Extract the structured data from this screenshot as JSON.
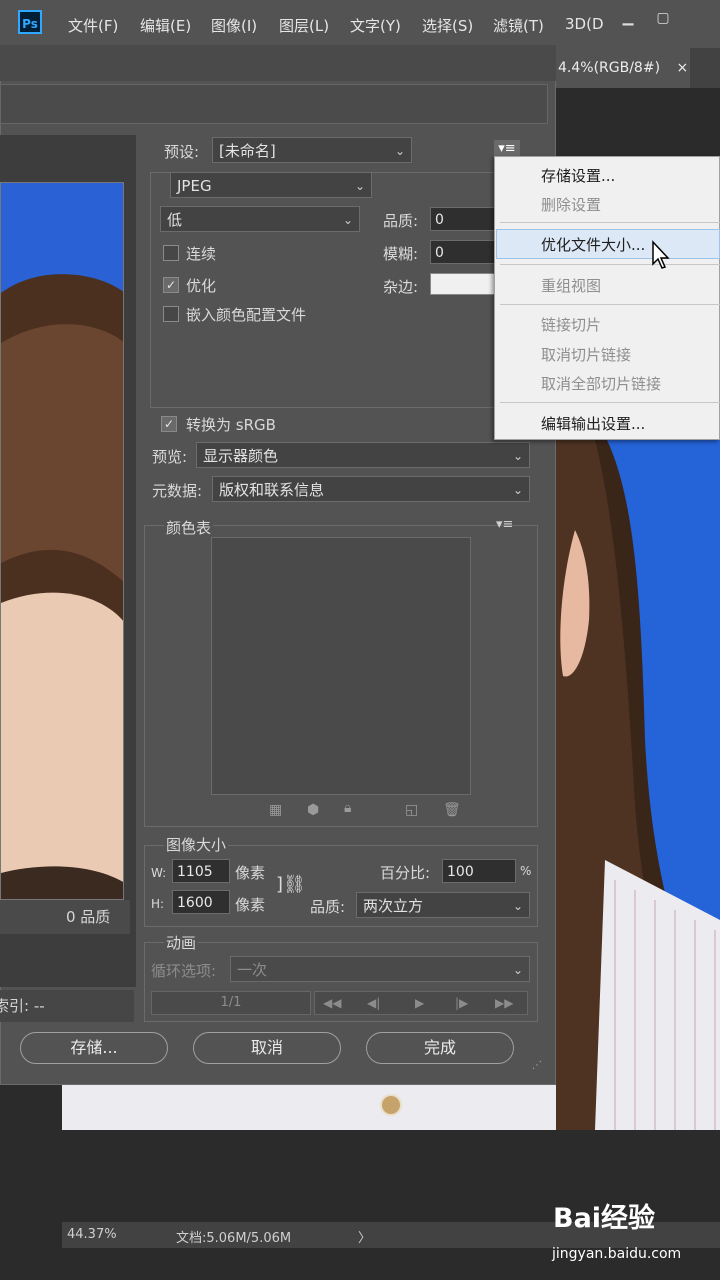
{
  "menubar": {
    "logo": "Ps",
    "items": [
      "文件(F)",
      "编辑(E)",
      "图像(I)",
      "图层(L)",
      "文字(Y)",
      "选择(S)",
      "滤镜(T)",
      "3D(D"
    ]
  },
  "document_tab": {
    "title": "4.4%(RGB/8#)",
    "close": "×"
  },
  "dialog": {
    "preset_label": "预设:",
    "preset_value": "[未命名]",
    "format": "JPEG",
    "quality_preset": "低",
    "quality_label": "品质:",
    "quality_value": "0",
    "blur_label": "模糊:",
    "blur_value": "0",
    "matte_label": "杂边:",
    "progressive_label": "连续",
    "optimized_label": "优化",
    "embed_profile_label": "嵌入颜色配置文件",
    "convert_srgb_label": "转换为 sRGB",
    "preview_label": "预览:",
    "preview_value": "显示器颜色",
    "metadata_label": "元数据:",
    "metadata_value": "版权和联系信息",
    "color_table_label": "颜色表",
    "image_size_label": "图像大小",
    "width_label": "W:",
    "width_value": "1105",
    "height_label": "H:",
    "height_value": "1600",
    "px_unit": "像素",
    "percent_label": "百分比:",
    "percent_value": "100",
    "percent_unit": "%",
    "resample_label": "品质:",
    "resample_value": "两次立方",
    "animation_label": "动画",
    "loop_label": "循环选项:",
    "loop_value": "一次",
    "frame_counter": "1/1",
    "preview_quality": "0 品质",
    "preview_index": "索引: --",
    "buttons": {
      "save": "存储...",
      "cancel": "取消",
      "done": "完成"
    }
  },
  "context_menu": {
    "items": [
      {
        "label": "存储设置...",
        "enabled": true
      },
      {
        "label": "删除设置",
        "enabled": false
      },
      {
        "label": "优化文件大小...",
        "enabled": true,
        "highlighted": true
      },
      {
        "label": "重组视图",
        "enabled": false
      },
      {
        "label": "链接切片",
        "enabled": false
      },
      {
        "label": "取消切片链接",
        "enabled": false
      },
      {
        "label": "取消全部切片链接",
        "enabled": false
      },
      {
        "label": "编辑输出设置...",
        "enabled": true
      }
    ]
  },
  "statusbar": {
    "zoom": "44.37%",
    "doc": "文档:5.06M/5.06M",
    "arrow": "〉"
  },
  "watermark": {
    "logo": "Bai经验",
    "url": "jingyan.baidu.com"
  },
  "colors": {
    "blue_bg": "#2563d8",
    "ui_gray": "#535353",
    "menu_bg": "#f0f0f0"
  }
}
